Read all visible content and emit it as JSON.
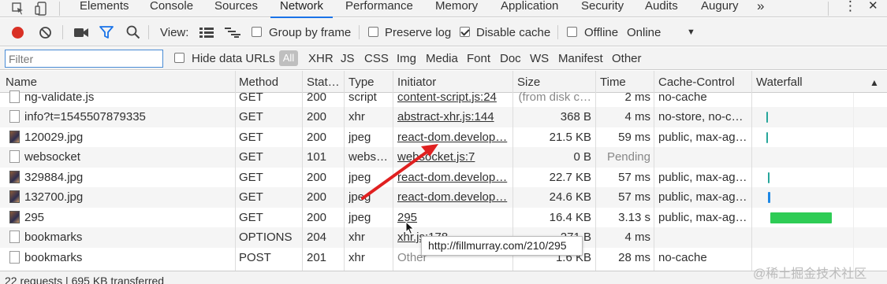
{
  "tabs": [
    "Elements",
    "Console",
    "Sources",
    "Network",
    "Performance",
    "Memory",
    "Application",
    "Security",
    "Audits",
    "Augury"
  ],
  "active_tab": "Network",
  "more_tabs": "»",
  "menu_glyph": "⋮",
  "close_glyph": "✕",
  "toolbar": {
    "view_label": "View:",
    "group_by_frame": "Group by frame",
    "preserve_log": "Preserve log",
    "disable_cache": "Disable cache",
    "offline": "Offline",
    "throttle": "Online",
    "dropdown_glyph": "▼",
    "disable_cache_checked": true
  },
  "filterbar": {
    "placeholder": "Filter",
    "hide_data_urls": "Hide data URLs",
    "all": "All",
    "types": [
      "XHR",
      "JS",
      "CSS",
      "Img",
      "Media",
      "Font",
      "Doc",
      "WS",
      "Manifest",
      "Other"
    ]
  },
  "columns": [
    "Name",
    "Method",
    "Stat…",
    "Type",
    "Initiator",
    "Size",
    "Time",
    "Cache-Control",
    "Waterfall"
  ],
  "sort_glyph": "▲",
  "rows": [
    {
      "name": "ng-validate.js",
      "method": "GET",
      "status": "200",
      "type": "script",
      "initiator": "content-script.js:24",
      "size": "(from disk c…",
      "time": "2 ms",
      "cache": "no-cache",
      "icon": "doc"
    },
    {
      "name": "info?t=1545507879335",
      "method": "GET",
      "status": "200",
      "type": "xhr",
      "initiator": "abstract-xhr.js:144",
      "size": "368 B",
      "time": "4 ms",
      "cache": "no-store, no-c…",
      "icon": "doc"
    },
    {
      "name": "120029.jpg",
      "method": "GET",
      "status": "200",
      "type": "jpeg",
      "initiator": "react-dom.develop…",
      "size": "21.5 KB",
      "time": "59 ms",
      "cache": "public, max-ag…",
      "icon": "img"
    },
    {
      "name": "websocket",
      "method": "GET",
      "status": "101",
      "type": "webs…",
      "initiator": "websocket.js:7",
      "size": "0 B",
      "time": "Pending",
      "cache": "",
      "icon": "doc"
    },
    {
      "name": "329884.jpg",
      "method": "GET",
      "status": "200",
      "type": "jpeg",
      "initiator": "react-dom.develop…",
      "size": "22.7 KB",
      "time": "57 ms",
      "cache": "public, max-ag…",
      "icon": "img"
    },
    {
      "name": "132700.jpg",
      "method": "GET",
      "status": "200",
      "type": "jpeg",
      "initiator": "react-dom.develop…",
      "size": "24.6 KB",
      "time": "57 ms",
      "cache": "public, max-ag…",
      "icon": "img"
    },
    {
      "name": "295",
      "method": "GET",
      "status": "200",
      "type": "jpeg",
      "initiator": "295",
      "size": "16.4 KB",
      "time": "3.13 s",
      "cache": "public, max-ag…",
      "icon": "img"
    },
    {
      "name": "bookmarks",
      "method": "OPTIONS",
      "status": "204",
      "type": "xhr",
      "initiator": "xhr.js:178",
      "size": "271 B",
      "time": "4 ms",
      "cache": "",
      "icon": "doc"
    },
    {
      "name": "bookmarks",
      "method": "POST",
      "status": "201",
      "type": "xhr",
      "initiator": "Other",
      "size": "1.6 KB",
      "time": "28 ms",
      "cache": "no-cache",
      "icon": "doc"
    }
  ],
  "tooltip": "http://fillmurray.com/210/295",
  "footer": "22 requests | 695 KB transferred",
  "watermark": "@稀土掘金技术社区",
  "colors": {
    "accent": "#1a73e8",
    "record": "#d93025",
    "filter_icon": "#1a73e8",
    "waterfall_teal": "#26a69a",
    "waterfall_blue": "#1e88e5",
    "waterfall_green": "#2ecc55",
    "arrow": "#e02020"
  }
}
